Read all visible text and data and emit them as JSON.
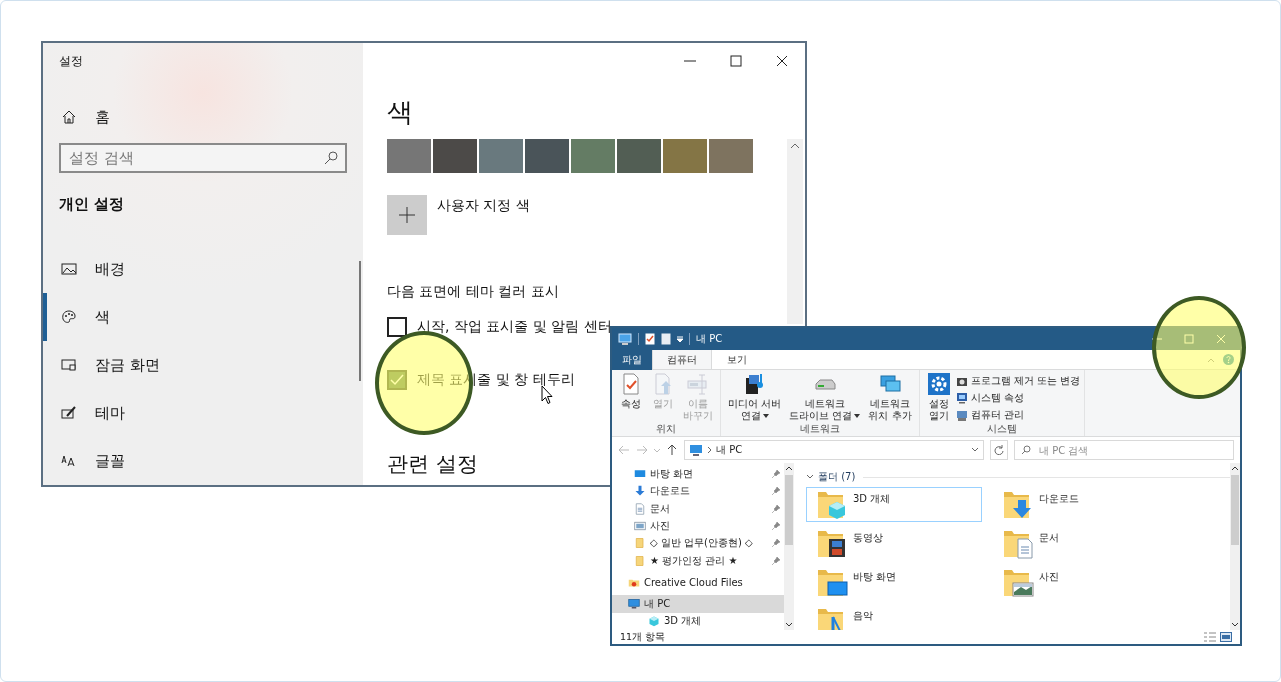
{
  "settings": {
    "title": "설정",
    "home": "홈",
    "search": {
      "placeholder": "설정 검색"
    },
    "section": "개인 설정",
    "nav": [
      {
        "label": "배경",
        "selected": false
      },
      {
        "label": "색",
        "selected": true
      },
      {
        "label": "잠금 화면",
        "selected": false
      },
      {
        "label": "테마",
        "selected": false
      },
      {
        "label": "글꼴",
        "selected": false
      }
    ],
    "heading": "색",
    "swatches": [
      {
        "color": "#767676"
      },
      {
        "color": "#4c4a48"
      },
      {
        "color": "#69797e"
      },
      {
        "color": "#4a5459"
      },
      {
        "color": "#647c64"
      },
      {
        "color": "#525e54"
      },
      {
        "color": "#847545"
      },
      {
        "color": "#7e735f"
      }
    ],
    "custom_color": "사용자 지정 색",
    "surfaces_label": "다음 표면에 테마 컬러 표시",
    "options": [
      {
        "label": "시작, 작업 표시줄 및 알림 센터",
        "checked": false
      },
      {
        "label": "제목 표시줄 및 창 테두리",
        "checked": true
      }
    ],
    "related_heading": "관련 설정"
  },
  "explorer": {
    "title": "내 PC",
    "file_tab": "파일",
    "tabs": [
      {
        "label": "컴퓨터",
        "selected": true
      },
      {
        "label": "보기",
        "selected": false
      }
    ],
    "ribbon": [
      {
        "group": "위치",
        "buttons": [
          {
            "label": "속성",
            "disabled": false
          },
          {
            "label": "열기",
            "disabled": true
          },
          {
            "label": "이름\n바꾸기",
            "disabled": true
          }
        ]
      },
      {
        "group": "네트워크",
        "buttons": [
          {
            "label": "미디어 서버\n연결",
            "dropdown": true
          },
          {
            "label": "네트워크\n드라이브 연결",
            "dropdown": true
          },
          {
            "label": "네트워크\n위치 추가",
            "dropdown": false
          }
        ]
      },
      {
        "group": "시스템",
        "buttons": [
          {
            "label": "설정\n열기"
          }
        ],
        "small_buttons": [
          "프로그램 제거 또는 변경",
          "시스템 속성",
          "컴퓨터 관리"
        ]
      }
    ],
    "address": "내 PC",
    "search": {
      "placeholder": "내 PC 검색"
    },
    "nav": [
      {
        "label": "바탕 화면",
        "pinned": true,
        "selected": false
      },
      {
        "label": "다운로드",
        "pinned": true,
        "selected": false
      },
      {
        "label": "문서",
        "pinned": true,
        "selected": false
      },
      {
        "label": "사진",
        "pinned": true,
        "selected": false
      },
      {
        "label": "◇ 일반 업무(안종현) ◇",
        "pinned": true,
        "selected": false
      },
      {
        "label": "★ 평가인정 관리 ★",
        "pinned": true,
        "selected": false
      },
      {
        "label": "Creative Cloud Files",
        "pinned": false,
        "selected": false
      },
      {
        "label": "내 PC",
        "pinned": false,
        "selected": true,
        "children": [
          {
            "label": "3D 개체",
            "pinned": false,
            "selected": false
          }
        ]
      }
    ],
    "content": {
      "group": "폴더 (7)",
      "items": [
        {
          "label": "3D 개체",
          "selected": true
        },
        {
          "label": "다운로드",
          "selected": false
        },
        {
          "label": "동영상",
          "selected": false
        },
        {
          "label": "문서",
          "selected": false
        },
        {
          "label": "바탕 화면",
          "selected": false
        },
        {
          "label": "사진",
          "selected": false
        },
        {
          "label": "음악",
          "selected": false
        }
      ]
    },
    "status": "11개 항목"
  }
}
